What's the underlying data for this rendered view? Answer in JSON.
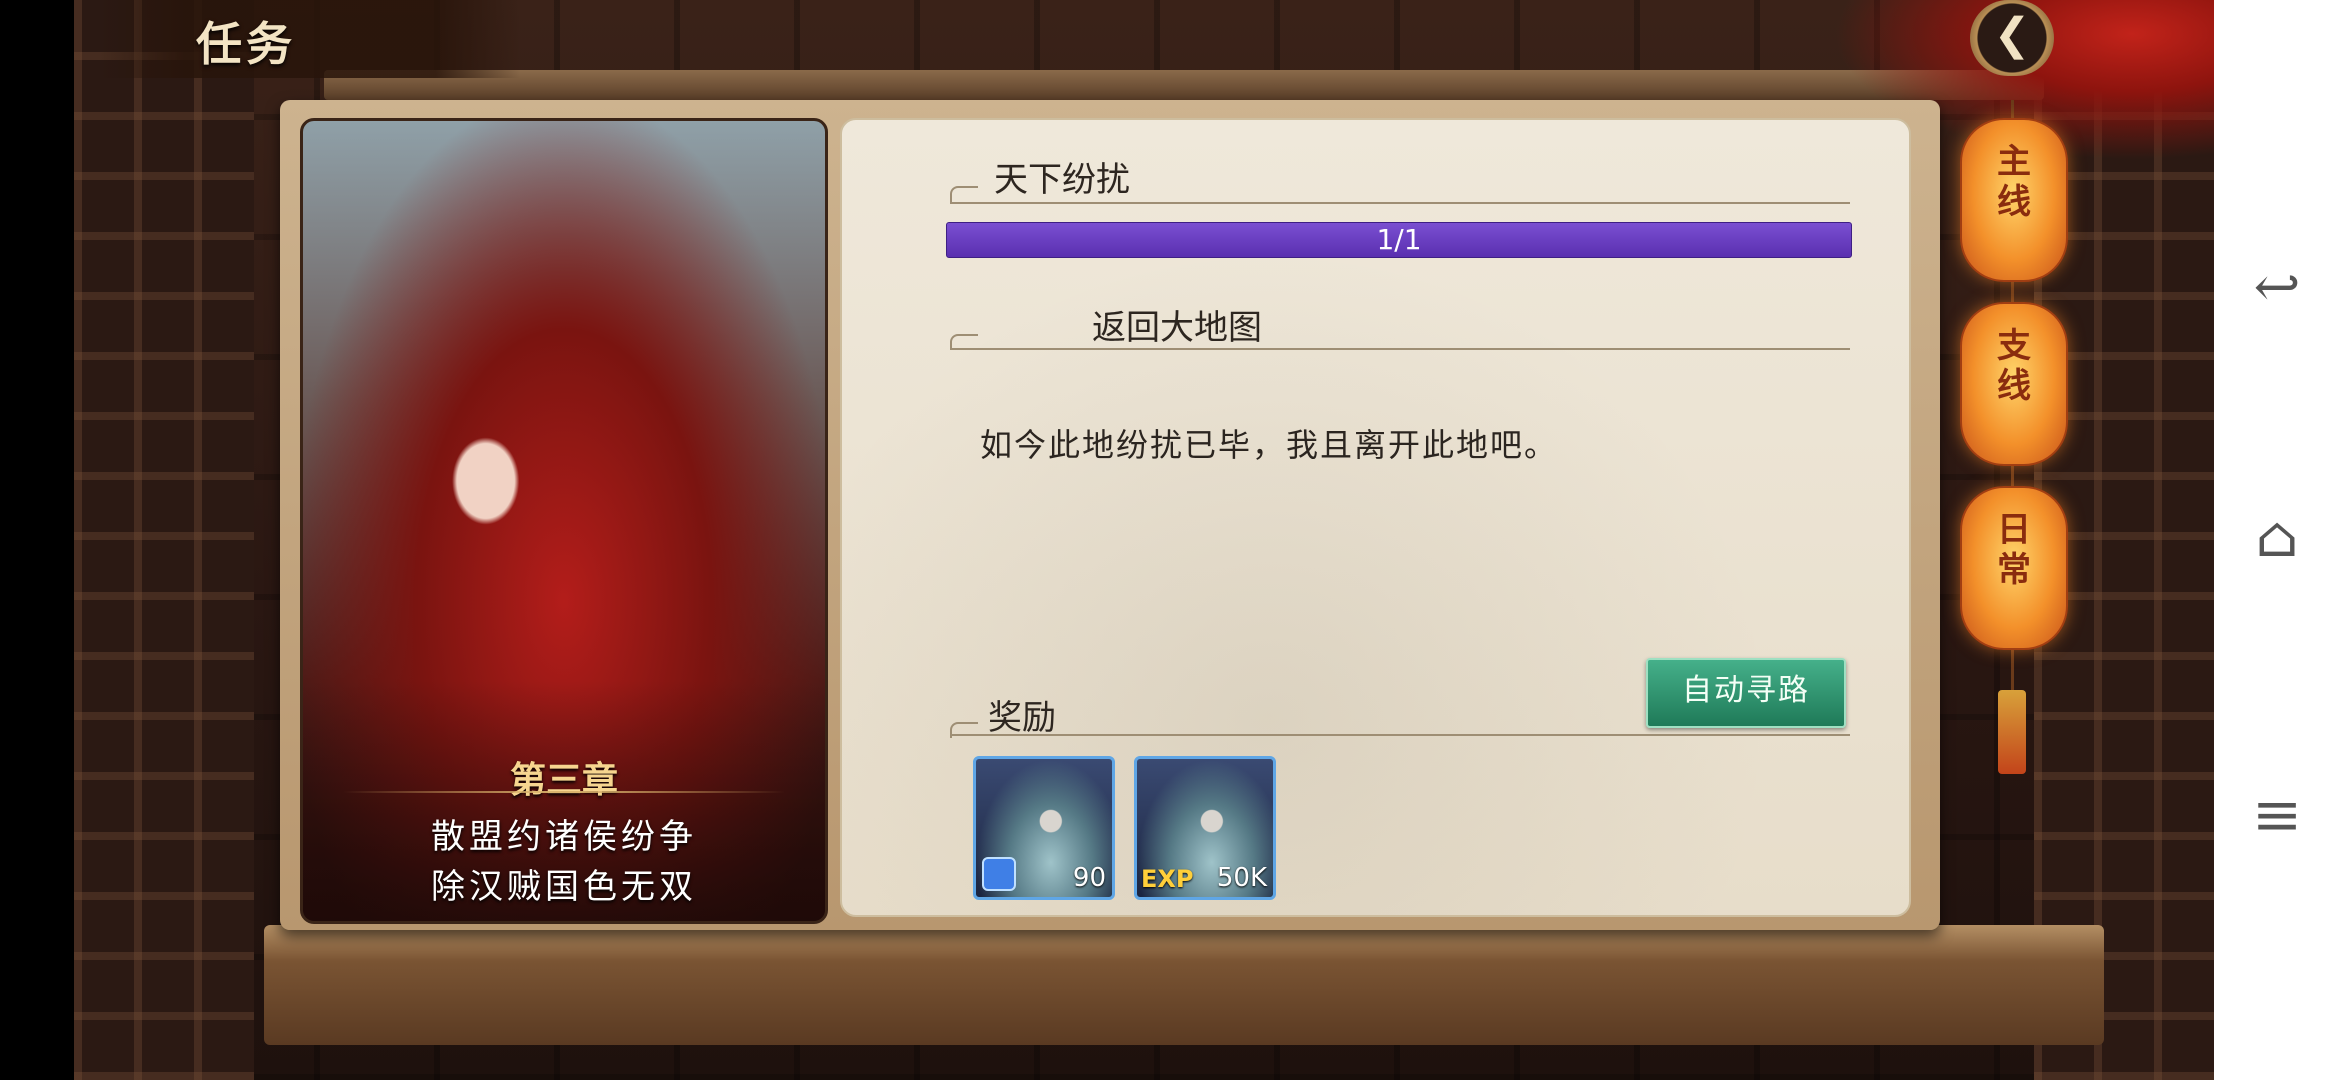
{
  "header": {
    "title": "任务",
    "back_icon": "back-arrow-icon"
  },
  "chapter_card": {
    "chapter": "第三章",
    "verse_line1": "散盟约诸侯纷争",
    "verse_line2": "除汉贼国色无双"
  },
  "quest": {
    "name": "天下纷扰",
    "progress_text": "1/1",
    "progress_ratio": 1.0,
    "objective": "返回大地图",
    "description": "如今此地纷扰已毕，我且离开此地吧。",
    "auto_path_label": "自动寻路"
  },
  "rewards": {
    "label": "奖励",
    "items": [
      {
        "badge": "",
        "count": "90"
      },
      {
        "badge": "EXP",
        "count": "50K"
      }
    ]
  },
  "tabs": [
    {
      "label": "主线"
    },
    {
      "label": "支线"
    },
    {
      "label": "日常"
    }
  ],
  "system_nav": {
    "back_icon": "↩",
    "home_icon": "⌂",
    "menu_icon": "≡"
  },
  "colors": {
    "progress": "#6a3fc4",
    "auto_button": "#2f9470",
    "lantern": "#f3902a"
  }
}
